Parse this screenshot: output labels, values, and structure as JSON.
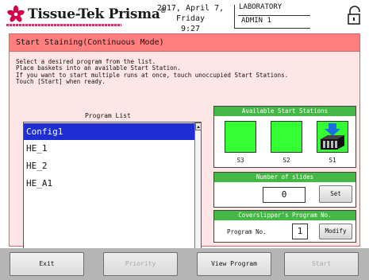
{
  "header": {
    "brand": "Tissue-Tek Prisma",
    "brand_mark": "®",
    "date": "2017, April 7, Friday",
    "time": "9:27",
    "location": "LABORATORY",
    "user": "ADMIN 1",
    "icons": {
      "logo": "flower-logo-icon",
      "lock": "lock-icon"
    }
  },
  "panel": {
    "title": "Start Staining(Continuous Mode)",
    "instructions": [
      "Select a desired program from the list.",
      "Place baskets into an available Start Station.",
      "If you want to start multiple runs at once, touch unoccupied Start Stations.",
      "Touch [Start] when ready."
    ],
    "program_list": {
      "label": "Program List",
      "items": [
        "Config1",
        "HE_1",
        "HE_2",
        "HE_A1"
      ],
      "selected_index": 0
    },
    "stations": {
      "title": "Available Start Stations",
      "items": [
        {
          "label": "S3",
          "state": "available"
        },
        {
          "label": "S2",
          "state": "available"
        },
        {
          "label": "S1",
          "state": "insert-basket",
          "icon": "basket-insert-icon"
        }
      ]
    },
    "slides": {
      "title": "Number of slides",
      "value": "0",
      "set_label": "Set"
    },
    "coverslipper": {
      "title": "Coverslipper's Program No.",
      "label": "Program No.",
      "value": "1",
      "modify_label": "Modify"
    }
  },
  "bottom_bar": {
    "buttons": [
      {
        "label": "Exit",
        "enabled": true
      },
      {
        "label": "Priority",
        "enabled": false
      },
      {
        "label": "View Program",
        "enabled": true
      },
      {
        "label": "Start",
        "enabled": false
      }
    ]
  },
  "colors": {
    "title_bar": "#ff7f7f",
    "panel_bg": "#ffe6e6",
    "section_header": "#44b844",
    "station_available": "#33ff33",
    "list_selected": "#1e2ed4",
    "brand": "#c0003a"
  }
}
